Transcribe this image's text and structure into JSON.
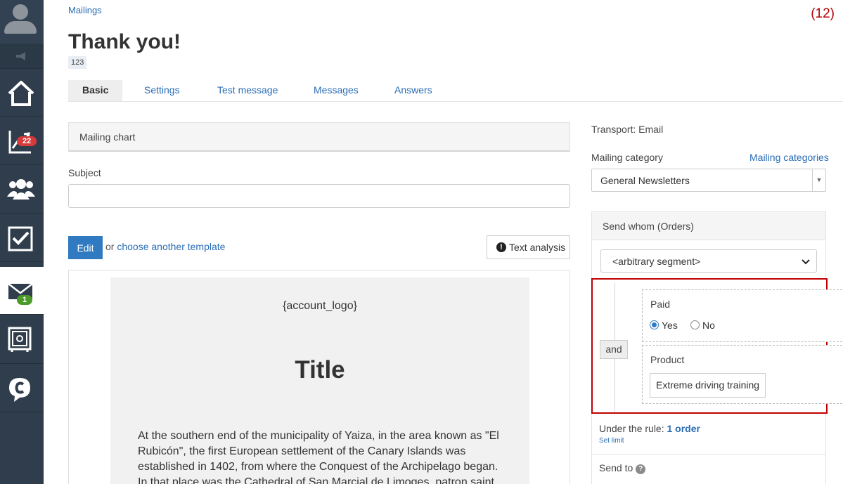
{
  "sidebar": {
    "items": [
      {
        "name": "home",
        "icon": "home-icon"
      },
      {
        "name": "statistics",
        "icon": "chart-icon",
        "badge": "22"
      },
      {
        "name": "contacts",
        "icon": "users-icon"
      },
      {
        "name": "tasks",
        "icon": "checkbox-icon"
      },
      {
        "name": "mailings",
        "icon": "envelope-icon",
        "badge": "1",
        "active": true
      },
      {
        "name": "safe",
        "icon": "safe-icon"
      },
      {
        "name": "chat",
        "icon": "chat-icon"
      }
    ]
  },
  "header": {
    "breadcrumb": "Mailings",
    "counter": "(12)",
    "title": "Thank you!",
    "id_tag": "123"
  },
  "tabs": [
    "Basic",
    "Settings",
    "Test message",
    "Messages",
    "Answers"
  ],
  "main": {
    "chart_panel": "Mailing chart",
    "subject_label": "Subject",
    "subject_value": "",
    "edit_button": "Edit",
    "or_text": "or",
    "choose_template": "choose another template",
    "text_analysis": "Text analysis",
    "preview": {
      "logo_placeholder": "{account_logo}",
      "title": "Title",
      "body": "At the southern end of the municipality of Yaiza, in the area known as \"El Rubicón\", the first European settlement of the Canary Islands was established in 1402, from where the Conquest of the Archipelago began. In that place was the Cathedral of San Marcial de Limoges, patron saint"
    }
  },
  "right": {
    "transport": "Transport: Email",
    "category_label": "Mailing category",
    "category_link": "Mailing categories",
    "category_value": "General Newsletters",
    "send_whom_header": "Send whom (Orders)",
    "segment_value": "<arbitrary segment>",
    "rule": {
      "operator": "and",
      "paid_label": "Paid",
      "paid_options": [
        "Yes",
        "No"
      ],
      "paid_selected": "Yes",
      "product_label": "Product",
      "product_value": "Extreme driving training"
    },
    "under_rule_prefix": "Under the rule:",
    "under_rule_count": "1 order",
    "set_limit": "Set limit",
    "send_to": "Send to"
  },
  "colors": {
    "sidebar_bg": "#2f3d4c",
    "link": "#2a6db5",
    "primary_button": "#2f7ac0",
    "highlight_border": "#c00000",
    "badge_red": "#d83a3a",
    "badge_green": "#4c9a2a"
  }
}
